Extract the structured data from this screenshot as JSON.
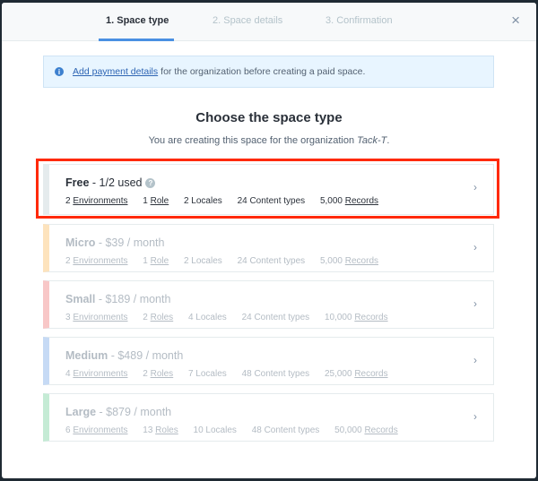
{
  "tabs": [
    {
      "label": "1. Space type",
      "active": true
    },
    {
      "label": "2. Space details"
    },
    {
      "label": "3. Confirmation"
    }
  ],
  "close_icon": "×",
  "notice": {
    "icon": "info-icon",
    "link": "Add payment details",
    "text": "for the organization before creating a paid space."
  },
  "title": "Choose the space type",
  "subtitle_prefix": "You are creating this space for the organization ",
  "org": "Tack-T",
  "subtitle_suffix": ".",
  "plans": [
    {
      "name": "Free",
      "price": " - 1/2 used",
      "color": "#e5ebed",
      "env": "2",
      "role": "1",
      "role_label": "Role",
      "locales": "2 Locales",
      "ct": "24 Content types",
      "rec": "5,000"
    },
    {
      "name": "Micro",
      "price": " - $39 / month",
      "color": "#fde3bd",
      "env": "2",
      "role": "1",
      "role_label": "Role",
      "locales": "2 Locales",
      "ct": "24 Content types",
      "rec": "5,000"
    },
    {
      "name": "Small",
      "price": " - $189 / month",
      "color": "#f8c7c7",
      "env": "3",
      "role": "2",
      "role_label": "Roles",
      "locales": "4 Locales",
      "ct": "24 Content types",
      "rec": "10,000"
    },
    {
      "name": "Medium",
      "price": " - $489 / month",
      "color": "#c6daf5",
      "env": "4",
      "role": "2",
      "role_label": "Roles",
      "locales": "7 Locales",
      "ct": "48 Content types",
      "rec": "25,000"
    },
    {
      "name": "Large",
      "price": " - $879 / month",
      "color": "#c5ebd5",
      "env": "6",
      "role": "13",
      "role_label": "Roles",
      "locales": "10 Locales",
      "ct": "48 Content types",
      "rec": "50,000"
    }
  ],
  "env_label": "Environments",
  "rec_label": "Records",
  "highlight_color": "#ff2a0a"
}
